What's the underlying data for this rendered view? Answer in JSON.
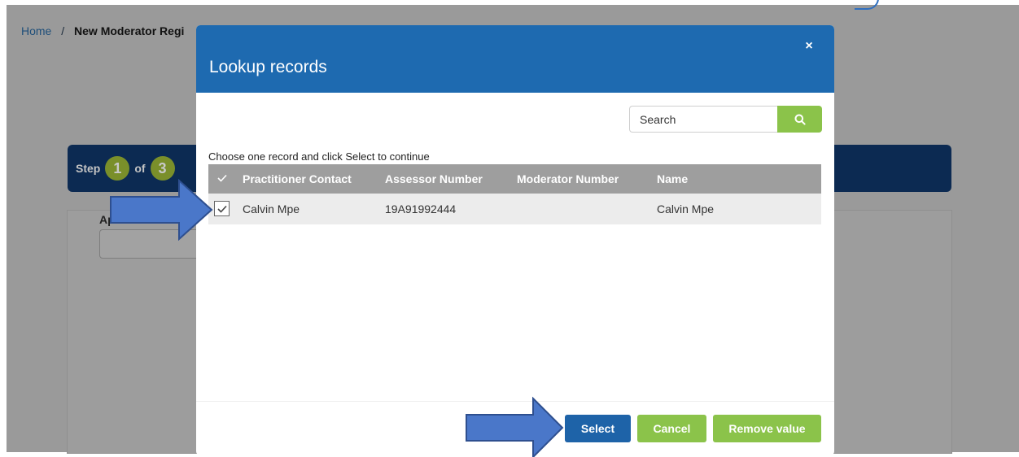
{
  "breadcrumb": {
    "home": "Home",
    "separator": "/",
    "current": "New Moderator Regi"
  },
  "wizard": {
    "step_word": "Step",
    "current_step": "1",
    "of_word": "of",
    "total_steps": "3",
    "field_label": "Ap"
  },
  "modal": {
    "title": "Lookup records",
    "close_glyph": "×",
    "search_placeholder": "Search",
    "instructions": "Choose one record and click Select to continue",
    "columns": [
      "Practitioner Contact",
      "Assessor Number",
      "Moderator Number",
      "Name"
    ],
    "rows": [
      {
        "checked": true,
        "practitioner_contact": "Calvin Mpe",
        "assessor_number": "19A91992444",
        "moderator_number": "",
        "name": "Calvin Mpe"
      }
    ],
    "buttons": {
      "select": "Select",
      "cancel": "Cancel",
      "remove": "Remove value"
    }
  },
  "colors": {
    "modal_header": "#1e6ab0",
    "accent_green": "#8bc34a",
    "select_button": "#1e63a8",
    "table_header": "#9e9e9e",
    "step_bar": "#0c2a52",
    "annotation_arrow": "#4a77c9"
  },
  "icons": {
    "search": "search-icon",
    "close": "close-icon",
    "check": "check-icon",
    "annotation": "arrow-annotation"
  }
}
